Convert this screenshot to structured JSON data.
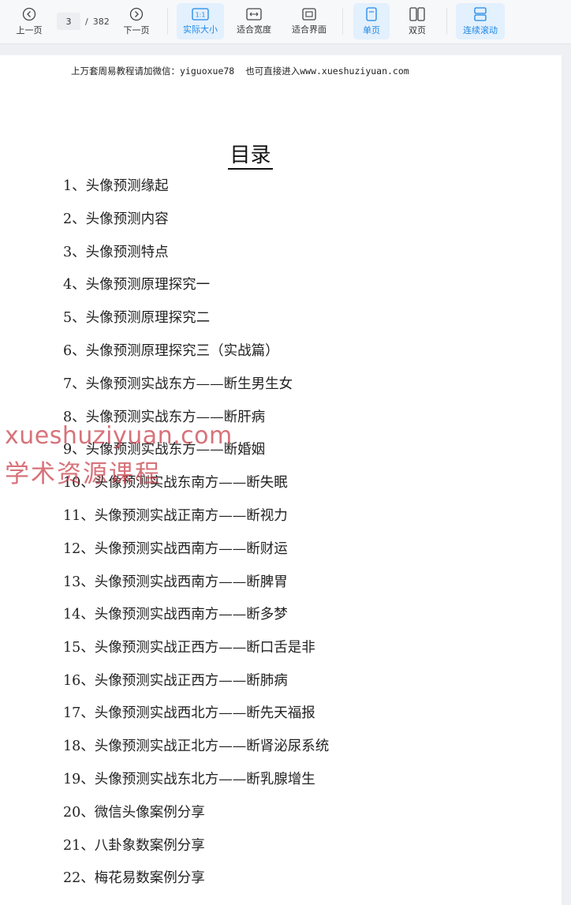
{
  "toolbar": {
    "prev_label": "上一页",
    "next_label": "下一页",
    "current_page": "3",
    "page_separator": "/",
    "total_pages": "382",
    "actual_size_icon_text": "1:1",
    "actual_size_label": "实际大小",
    "fit_width_label": "适合宽度",
    "fit_page_label": "适合界面",
    "single_page_label": "单页",
    "double_page_label": "双页",
    "continuous_label": "连续滚动",
    "accent_color": "#1e88e5"
  },
  "document": {
    "header_part1": "上万套周易教程请加微信：yiguoxue78",
    "header_part2": "也可直接进入www.xueshuziyuan.com",
    "toc_title": "目录",
    "toc_items": [
      "1、头像预测缘起",
      "2、头像预测内容",
      "3、头像预测特点",
      "4、头像预测原理探究一",
      "5、头像预测原理探究二",
      "6、头像预测原理探究三（实战篇）",
      "7、头像预测实战东方——断生男生女",
      "8、头像预测实战东方——断肝病",
      "9、头像预测实战东方——断婚姻",
      "10、头像预测实战东南方——断失眠",
      "11、头像预测实战正南方——断视力",
      "12、头像预测实战西南方——断财运",
      "13、头像预测实战西南方——断脾胃",
      "14、头像预测实战西南方——断多梦",
      "15、头像预测实战正西方——断口舌是非",
      "16、头像预测实战正西方——断肺病",
      "17、头像预测实战西北方——断先天福报",
      "18、头像预测实战正北方——断肾泌尿系统",
      "19、头像预测实战东北方——断乳腺增生",
      "20、微信头像案例分享",
      "21、八卦象数案例分享",
      "22、梅花易数案例分享"
    ]
  },
  "watermark": {
    "line1": "xueshuziyuan.com",
    "line2": "学术资源课程",
    "color": "#c83c46"
  }
}
